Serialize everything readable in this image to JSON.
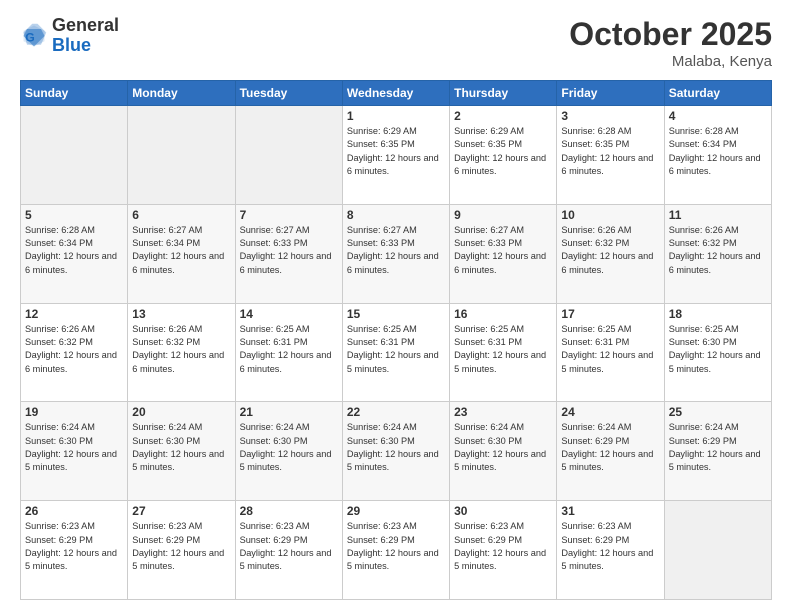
{
  "header": {
    "logo_general": "General",
    "logo_blue": "Blue",
    "month_title": "October 2025",
    "location": "Malaba, Kenya"
  },
  "days_of_week": [
    "Sunday",
    "Monday",
    "Tuesday",
    "Wednesday",
    "Thursday",
    "Friday",
    "Saturday"
  ],
  "weeks": [
    [
      {
        "day": "",
        "empty": true
      },
      {
        "day": "",
        "empty": true
      },
      {
        "day": "",
        "empty": true
      },
      {
        "day": "1",
        "sunrise": "6:29 AM",
        "sunset": "6:35 PM",
        "daylight": "12 hours and 6 minutes."
      },
      {
        "day": "2",
        "sunrise": "6:29 AM",
        "sunset": "6:35 PM",
        "daylight": "12 hours and 6 minutes."
      },
      {
        "day": "3",
        "sunrise": "6:28 AM",
        "sunset": "6:35 PM",
        "daylight": "12 hours and 6 minutes."
      },
      {
        "day": "4",
        "sunrise": "6:28 AM",
        "sunset": "6:34 PM",
        "daylight": "12 hours and 6 minutes."
      }
    ],
    [
      {
        "day": "5",
        "sunrise": "6:28 AM",
        "sunset": "6:34 PM",
        "daylight": "12 hours and 6 minutes."
      },
      {
        "day": "6",
        "sunrise": "6:27 AM",
        "sunset": "6:34 PM",
        "daylight": "12 hours and 6 minutes."
      },
      {
        "day": "7",
        "sunrise": "6:27 AM",
        "sunset": "6:33 PM",
        "daylight": "12 hours and 6 minutes."
      },
      {
        "day": "8",
        "sunrise": "6:27 AM",
        "sunset": "6:33 PM",
        "daylight": "12 hours and 6 minutes."
      },
      {
        "day": "9",
        "sunrise": "6:27 AM",
        "sunset": "6:33 PM",
        "daylight": "12 hours and 6 minutes."
      },
      {
        "day": "10",
        "sunrise": "6:26 AM",
        "sunset": "6:32 PM",
        "daylight": "12 hours and 6 minutes."
      },
      {
        "day": "11",
        "sunrise": "6:26 AM",
        "sunset": "6:32 PM",
        "daylight": "12 hours and 6 minutes."
      }
    ],
    [
      {
        "day": "12",
        "sunrise": "6:26 AM",
        "sunset": "6:32 PM",
        "daylight": "12 hours and 6 minutes."
      },
      {
        "day": "13",
        "sunrise": "6:26 AM",
        "sunset": "6:32 PM",
        "daylight": "12 hours and 6 minutes."
      },
      {
        "day": "14",
        "sunrise": "6:25 AM",
        "sunset": "6:31 PM",
        "daylight": "12 hours and 6 minutes."
      },
      {
        "day": "15",
        "sunrise": "6:25 AM",
        "sunset": "6:31 PM",
        "daylight": "12 hours and 5 minutes."
      },
      {
        "day": "16",
        "sunrise": "6:25 AM",
        "sunset": "6:31 PM",
        "daylight": "12 hours and 5 minutes."
      },
      {
        "day": "17",
        "sunrise": "6:25 AM",
        "sunset": "6:31 PM",
        "daylight": "12 hours and 5 minutes."
      },
      {
        "day": "18",
        "sunrise": "6:25 AM",
        "sunset": "6:30 PM",
        "daylight": "12 hours and 5 minutes."
      }
    ],
    [
      {
        "day": "19",
        "sunrise": "6:24 AM",
        "sunset": "6:30 PM",
        "daylight": "12 hours and 5 minutes."
      },
      {
        "day": "20",
        "sunrise": "6:24 AM",
        "sunset": "6:30 PM",
        "daylight": "12 hours and 5 minutes."
      },
      {
        "day": "21",
        "sunrise": "6:24 AM",
        "sunset": "6:30 PM",
        "daylight": "12 hours and 5 minutes."
      },
      {
        "day": "22",
        "sunrise": "6:24 AM",
        "sunset": "6:30 PM",
        "daylight": "12 hours and 5 minutes."
      },
      {
        "day": "23",
        "sunrise": "6:24 AM",
        "sunset": "6:30 PM",
        "daylight": "12 hours and 5 minutes."
      },
      {
        "day": "24",
        "sunrise": "6:24 AM",
        "sunset": "6:29 PM",
        "daylight": "12 hours and 5 minutes."
      },
      {
        "day": "25",
        "sunrise": "6:24 AM",
        "sunset": "6:29 PM",
        "daylight": "12 hours and 5 minutes."
      }
    ],
    [
      {
        "day": "26",
        "sunrise": "6:23 AM",
        "sunset": "6:29 PM",
        "daylight": "12 hours and 5 minutes."
      },
      {
        "day": "27",
        "sunrise": "6:23 AM",
        "sunset": "6:29 PM",
        "daylight": "12 hours and 5 minutes."
      },
      {
        "day": "28",
        "sunrise": "6:23 AM",
        "sunset": "6:29 PM",
        "daylight": "12 hours and 5 minutes."
      },
      {
        "day": "29",
        "sunrise": "6:23 AM",
        "sunset": "6:29 PM",
        "daylight": "12 hours and 5 minutes."
      },
      {
        "day": "30",
        "sunrise": "6:23 AM",
        "sunset": "6:29 PM",
        "daylight": "12 hours and 5 minutes."
      },
      {
        "day": "31",
        "sunrise": "6:23 AM",
        "sunset": "6:29 PM",
        "daylight": "12 hours and 5 minutes."
      },
      {
        "day": "",
        "empty": true
      }
    ]
  ]
}
